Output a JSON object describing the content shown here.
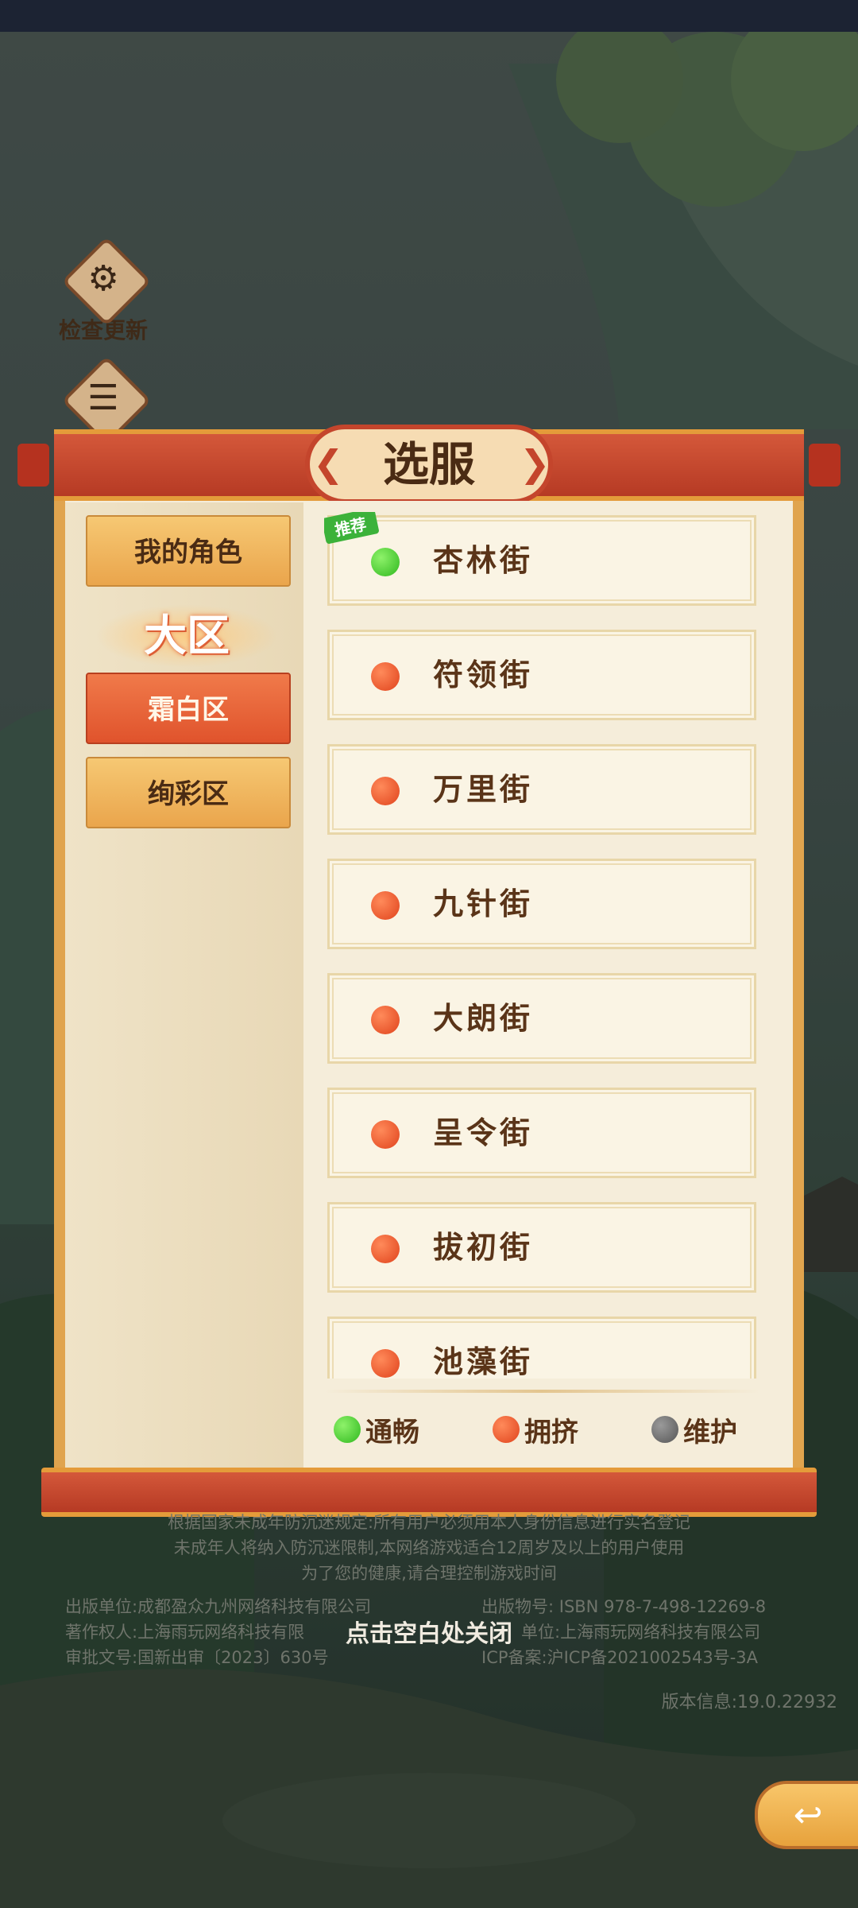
{
  "sidebar_buttons": [
    {
      "label": "检查更新",
      "icon": "search-gear-icon"
    },
    {
      "label": "",
      "icon": "notice-box-icon"
    }
  ],
  "panel": {
    "title": "选服",
    "tabs": {
      "my_roles": "我的角色",
      "region_header": "大区",
      "regions": [
        "霜白区",
        "绚彩区"
      ]
    },
    "servers": [
      {
        "name": "杏林街",
        "status": "green",
        "tag": "推荐"
      },
      {
        "name": "符领街",
        "status": "red"
      },
      {
        "name": "万里街",
        "status": "red"
      },
      {
        "name": "九针街",
        "status": "red"
      },
      {
        "name": "大朗街",
        "status": "red"
      },
      {
        "name": "呈令街",
        "status": "red"
      },
      {
        "name": "拔初街",
        "status": "red"
      },
      {
        "name": "池藻街",
        "status": "red"
      }
    ],
    "legend": [
      {
        "label": "通畅",
        "color": "#2fb81e"
      },
      {
        "label": "拥挤",
        "color": "#e0431c"
      },
      {
        "label": "维护",
        "color": "#555555"
      }
    ]
  },
  "notice": {
    "line1": "根据国家未成年防沉迷规定:所有用户必须用本人身份信息进行实名登记",
    "line2": "未成年人将纳入防沉迷限制,本网络游戏适合12周岁及以上的用户使用",
    "line3": "为了您的健康,请合理控制游戏时间"
  },
  "publish_info": {
    "publisher": "出版单位:成都盈众九州网络科技有限公司",
    "isbn": "出版物号: ISBN 978-7-498-12269-8",
    "copyright": "著作权人:上海雨玩网络科技有限",
    "operator": "单位:上海雨玩网络科技有限公司",
    "approval": "审批文号:国新出审〔2023〕630号",
    "icp": "ICP备案:沪ICP备2021002543号-3A"
  },
  "close_hint": "点击空白处关闭",
  "version": "版本信息:19.0.22932"
}
